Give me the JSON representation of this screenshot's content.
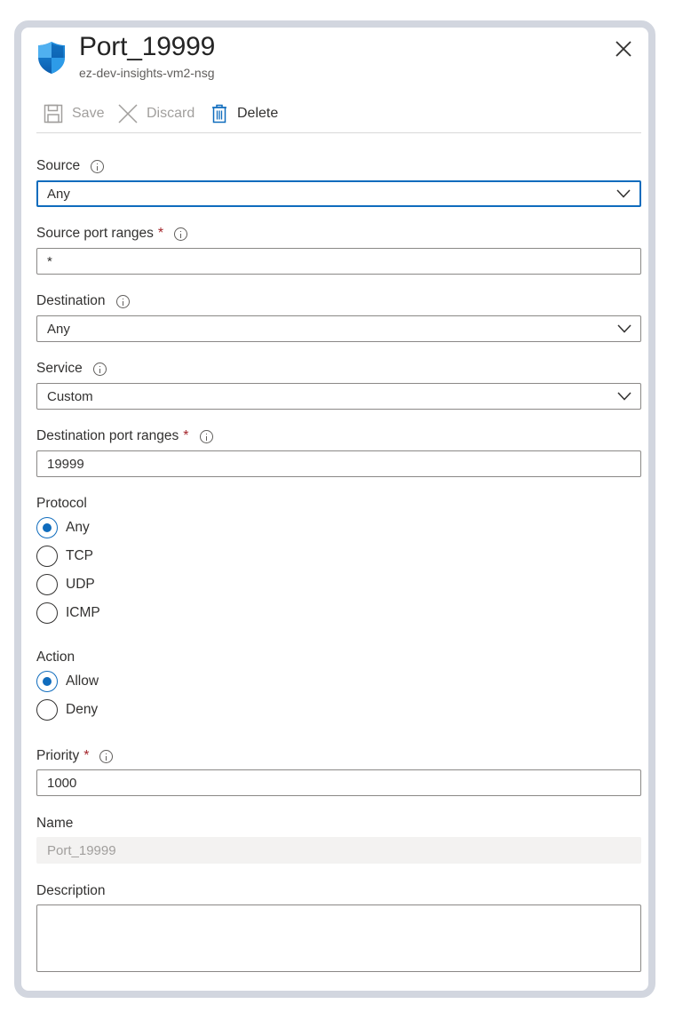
{
  "header": {
    "title": "Port_19999",
    "subtitle": "ez-dev-insights-vm2-nsg",
    "icon": "shield-icon",
    "close_icon": "close-icon"
  },
  "toolbar": {
    "save_label": "Save",
    "discard_label": "Discard",
    "delete_label": "Delete"
  },
  "form": {
    "source": {
      "label": "Source",
      "value": "Any"
    },
    "source_port_ranges": {
      "label": "Source port ranges",
      "required": "*",
      "value": "*"
    },
    "destination": {
      "label": "Destination",
      "value": "Any"
    },
    "service": {
      "label": "Service",
      "value": "Custom"
    },
    "destination_port_ranges": {
      "label": "Destination port ranges",
      "required": "*",
      "value": "19999"
    },
    "protocol": {
      "label": "Protocol",
      "options": [
        "Any",
        "TCP",
        "UDP",
        "ICMP"
      ],
      "selected": "Any"
    },
    "action": {
      "label": "Action",
      "options": [
        "Allow",
        "Deny"
      ],
      "selected": "Allow"
    },
    "priority": {
      "label": "Priority",
      "required": "*",
      "value": "1000"
    },
    "name": {
      "label": "Name",
      "value": "Port_19999"
    },
    "description": {
      "label": "Description",
      "value": ""
    }
  },
  "colors": {
    "accent": "#0f6cbd",
    "required": "#a4262c",
    "disabled_text": "#a19f9d",
    "frame": "#d2d6df"
  }
}
